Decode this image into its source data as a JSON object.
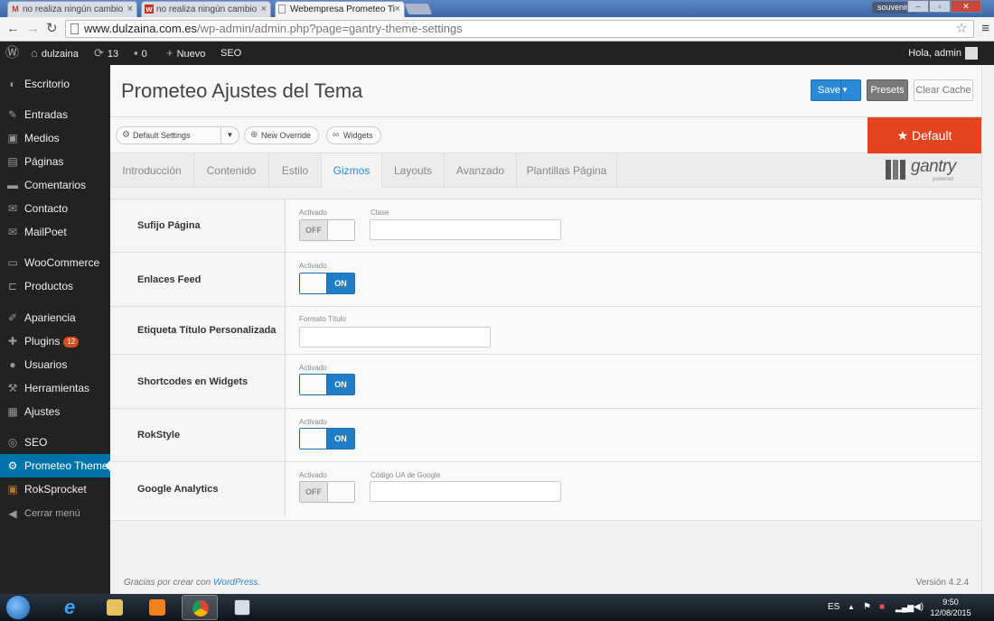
{
  "browser": {
    "tabs": [
      {
        "favicon": "M",
        "label": "no realiza ningún cambio"
      },
      {
        "favicon": "w",
        "label": "no realiza ningún cambio"
      },
      {
        "favicon": "",
        "label": "Webempresa Prometeo Ti"
      }
    ],
    "profile": "souvenirs",
    "url_host": "www.dulzaina.com.es",
    "url_path": "/wp-admin/admin.php?page=gantry-theme-settings"
  },
  "adminbar": {
    "site": "dulzaina",
    "updates": "13",
    "comments": "0",
    "new": "Nuevo",
    "seo": "SEO",
    "greeting": "Hola, admin"
  },
  "sidebar": {
    "items": [
      {
        "label": "Escritorio",
        "icon": "dashboard-icon"
      },
      {
        "label": "Entradas",
        "icon": "pin-icon"
      },
      {
        "label": "Medios",
        "icon": "media-icon"
      },
      {
        "label": "Páginas",
        "icon": "pages-icon"
      },
      {
        "label": "Comentarios",
        "icon": "comment-icon"
      },
      {
        "label": "Contacto",
        "icon": "mail-icon"
      },
      {
        "label": "MailPoet",
        "icon": "mail-icon"
      },
      {
        "label": "WooCommerce",
        "icon": "woo-icon"
      },
      {
        "label": "Productos",
        "icon": "cart-icon"
      },
      {
        "label": "Apariencia",
        "icon": "brush-icon"
      },
      {
        "label": "Plugins",
        "icon": "plugin-icon",
        "badge": "12"
      },
      {
        "label": "Usuarios",
        "icon": "user-icon"
      },
      {
        "label": "Herramientas",
        "icon": "wrench-icon"
      },
      {
        "label": "Ajustes",
        "icon": "settings-icon"
      },
      {
        "label": "SEO",
        "icon": "seo-icon"
      },
      {
        "label": "Prometeo Theme",
        "icon": "gear-icon"
      },
      {
        "label": "RokSprocket",
        "icon": "rok-icon"
      }
    ],
    "collapse": "Cerrar menú"
  },
  "header": {
    "title": "Prometeo Ajustes del Tema",
    "save": "Save",
    "presets": "Presets",
    "clear_cache": "Clear Cache"
  },
  "toolbar": {
    "settings_select": "Default Settings",
    "new_override": "New Override",
    "widgets": "Widgets",
    "default_flag": "★ Default"
  },
  "tabs": [
    "Introducción",
    "Contenido",
    "Estilo",
    "Gizmos",
    "Layouts",
    "Avanzado",
    "Plantillas Página"
  ],
  "active_tab": "Gizmos",
  "gantry": {
    "word": "gantry",
    "sub": "powered"
  },
  "rows": [
    {
      "label": "Sufijo Página",
      "cap1": "Activado",
      "toggle": "OFF",
      "cap2": "Clase"
    },
    {
      "label": "Enlaces Feed",
      "cap1": "Activado",
      "toggle": "ON"
    },
    {
      "label": "Etiqueta Título Personalizada",
      "cap1": "Formato Título"
    },
    {
      "label": "Shortcodes en Widgets",
      "cap1": "Activado",
      "toggle": "ON"
    },
    {
      "label": "RokStyle",
      "cap1": "Activado",
      "toggle": "ON"
    },
    {
      "label": "Google Analytics",
      "cap1": "Activado",
      "toggle": "OFF",
      "cap2": "Código UA de Google"
    }
  ],
  "footer": {
    "thanks": "Gracias por crear con ",
    "wp": "WordPress",
    "dot": ".",
    "version": "Versión 4.2.4"
  },
  "taskbar": {
    "lang": "ES",
    "time": "9:50",
    "date": "12/08/2015"
  },
  "colors": {
    "accent": "#0073aa",
    "save": "#2b8ad6",
    "default_flag": "#e3431f",
    "badge": "#d54e21"
  }
}
